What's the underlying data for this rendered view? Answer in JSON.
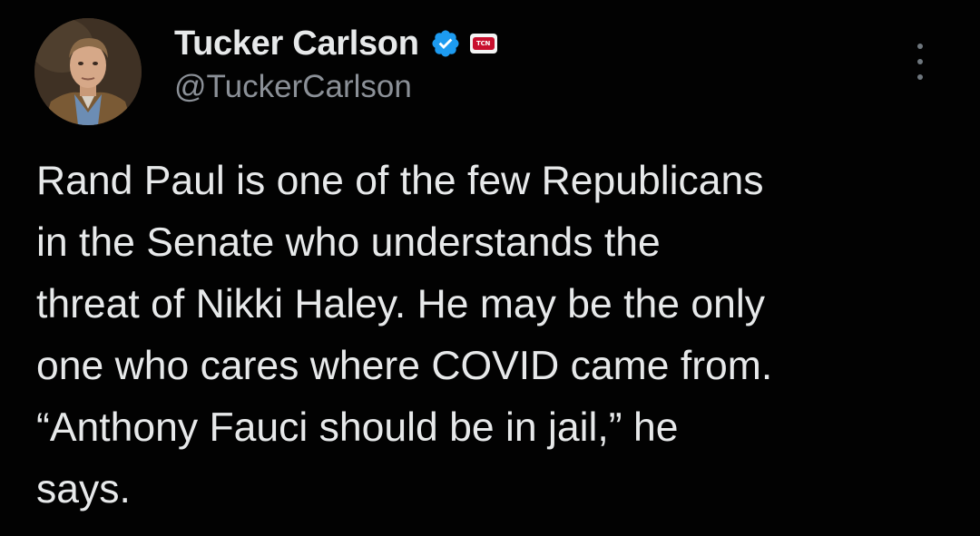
{
  "author": {
    "display_name": "Tucker Carlson",
    "handle": "@TuckerCarlson",
    "verified_icon": "verified-badge-icon",
    "affiliate_badge_text": "TCN",
    "avatar_icon": "profile-avatar"
  },
  "menu": {
    "icon": "more-options-icon"
  },
  "tweet": {
    "lines": [
      "Rand Paul is one of the few Republicans",
      "in the Senate who understands the",
      "threat of Nikki Haley. He may be the only",
      "one who cares where COVID came from.",
      "“Anthony Fauci should be in jail,” he",
      "says."
    ]
  },
  "colors": {
    "background": "#020202",
    "text": "#e7e9ea",
    "secondary_text": "#8b9097",
    "verified_blue": "#1d9bf0",
    "badge_red": "#c8102e"
  }
}
